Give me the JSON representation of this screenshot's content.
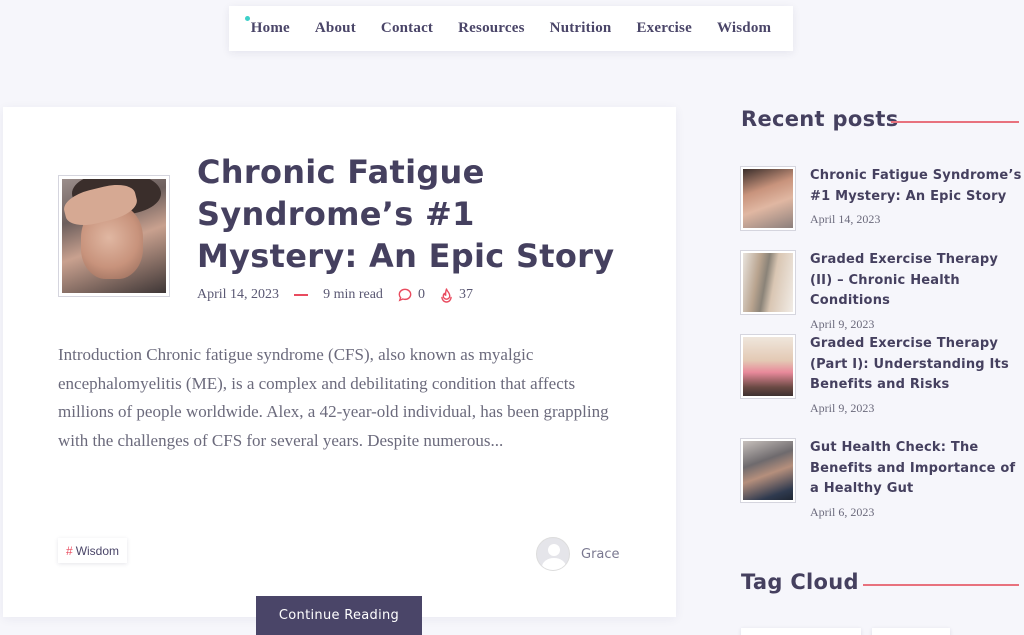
{
  "nav": {
    "items": [
      "Home",
      "About",
      "Contact",
      "Resources",
      "Nutrition",
      "Exercise",
      "Wisdom"
    ]
  },
  "post": {
    "title": "Chronic Fatigue Syndrome’s #1 Mystery: An Epic Story",
    "date": "April 14, 2023",
    "read_time": "9 min read",
    "comments": "0",
    "likes": "37",
    "excerpt": "Introduction Chronic fatigue syndrome (CFS), also known as myalgic encephalomyelitis (ME), is a complex and debilitating condition that affects millions of people worldwide. Alex, a 42-year-old individual, has been grappling with the challenges of CFS for several years. Despite numerous...",
    "tag": "Wisdom",
    "author": "Grace",
    "continue_label": "Continue Reading"
  },
  "sidebar": {
    "recent_title": "Recent posts",
    "recent": [
      {
        "title": "Chronic Fatigue Syndrome’s #1 Mystery: An Epic Story",
        "date": "April 14, 2023"
      },
      {
        "title": "Graded Exercise Therapy (II) – Chronic Health Conditions",
        "date": "April 9, 2023"
      },
      {
        "title": "Graded Exercise Therapy (Part I): Understanding Its Benefits and Risks",
        "date": "April 9, 2023"
      },
      {
        "title": "Gut Health Check: The Benefits and Importance of a Healthy Gut",
        "date": "April 6, 2023"
      }
    ],
    "tag_cloud_title": "Tag Cloud"
  },
  "colors": {
    "accent": "#e94b5f",
    "heading": "#45405f",
    "button": "#4a4568",
    "nav_dot": "#3ed0c9"
  }
}
